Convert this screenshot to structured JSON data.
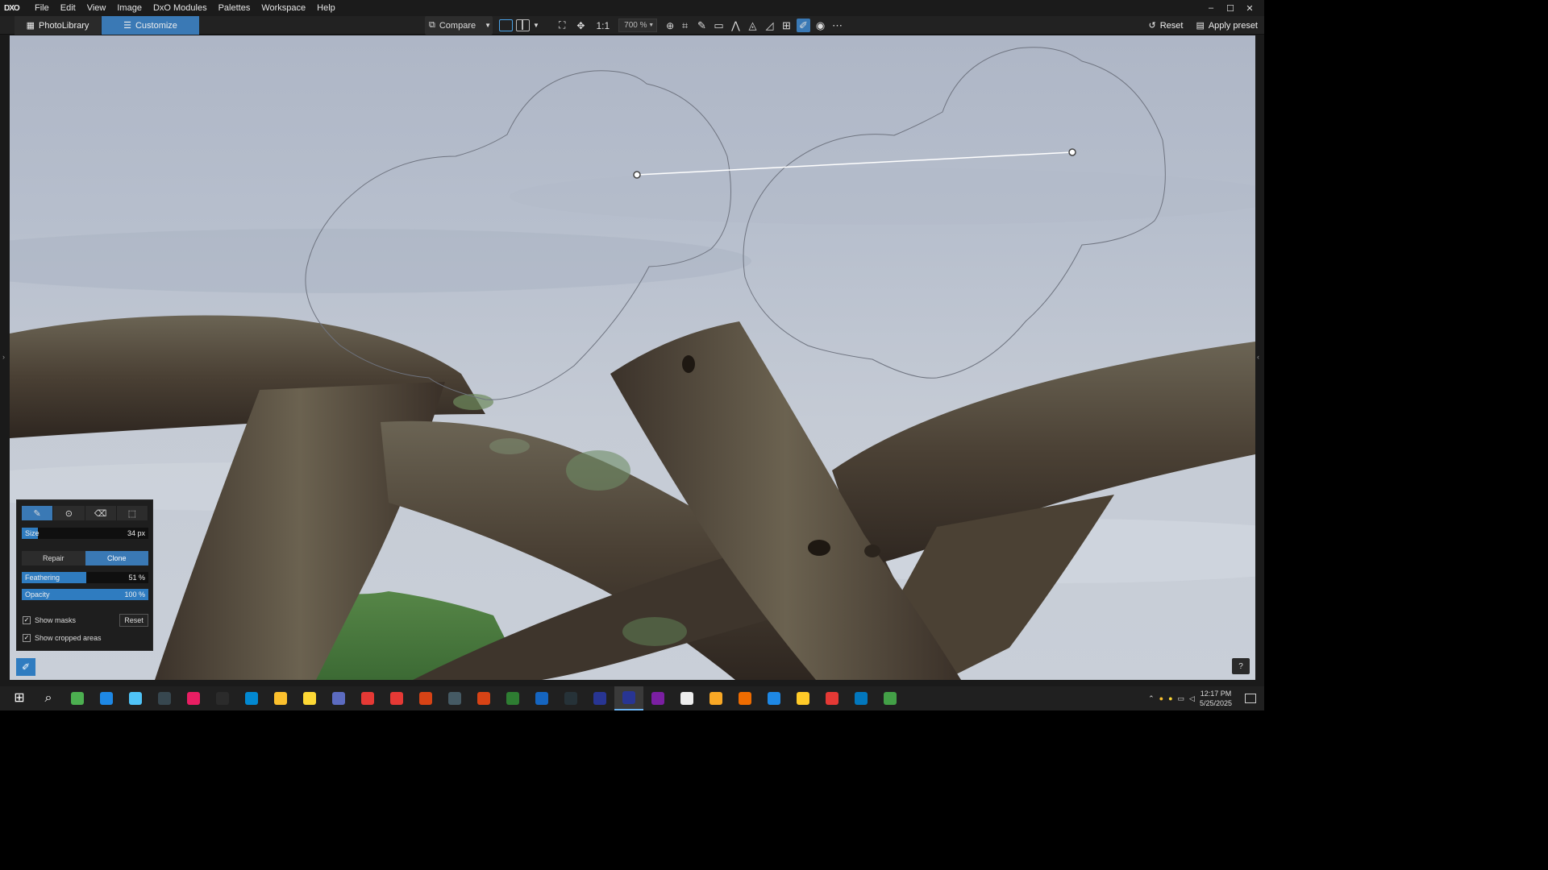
{
  "menubar": {
    "logo": "DXO",
    "items": [
      "File",
      "Edit",
      "View",
      "Image",
      "DxO Modules",
      "Palettes",
      "Workspace",
      "Help"
    ],
    "window_controls": [
      "–",
      "☐",
      "✕"
    ]
  },
  "toolbar": {
    "tab_library": "PhotoLibrary",
    "tab_customize": "Customize",
    "compare_label": "Compare",
    "one_to_one": "1:1",
    "zoom_value": "700 %",
    "reset_label": "Reset",
    "apply_preset_label": "Apply preset"
  },
  "palette": {
    "size_label": "Size",
    "size_value": "34 px",
    "size_fraction": 0.13,
    "mode_repair": "Repair",
    "mode_clone": "Clone",
    "feathering_label": "Feathering",
    "feathering_value": "51 %",
    "feathering_fraction": 0.51,
    "opacity_label": "Opacity",
    "opacity_value": "100 %",
    "opacity_fraction": 1.0,
    "show_masks_label": "Show masks",
    "show_masks_checked": true,
    "reset_label": "Reset",
    "show_cropped_label": "Show cropped areas",
    "show_cropped_checked": true
  },
  "help_label": "?",
  "taskbar": {
    "time": "12:17 PM",
    "date": "5/25/2025",
    "apps": [
      {
        "name": "start",
        "color": "#2b2b2b",
        "glyph": "⊞"
      },
      {
        "name": "search",
        "color": "#2b2b2b",
        "glyph": "⌕"
      },
      {
        "name": "app-bird",
        "color": "#4caf50",
        "glyph": ""
      },
      {
        "name": "edge",
        "color": "#1e88e5",
        "glyph": ""
      },
      {
        "name": "mail",
        "color": "#4fc3f7",
        "glyph": ""
      },
      {
        "name": "app-dark",
        "color": "#37474f",
        "glyph": ""
      },
      {
        "name": "itunes",
        "color": "#e91e63",
        "glyph": ""
      },
      {
        "name": "speed",
        "color": "#2b2b2b",
        "glyph": ""
      },
      {
        "name": "store",
        "color": "#0288d1",
        "glyph": ""
      },
      {
        "name": "explorer",
        "color": "#fbc02d",
        "glyph": ""
      },
      {
        "name": "app-yellow",
        "color": "#fdd835",
        "glyph": ""
      },
      {
        "name": "app-gray",
        "color": "#5c6bc0",
        "glyph": ""
      },
      {
        "name": "app-red",
        "color": "#e53935",
        "glyph": ""
      },
      {
        "name": "todo",
        "color": "#e53935",
        "glyph": ""
      },
      {
        "name": "acrobat",
        "color": "#d84315",
        "glyph": ""
      },
      {
        "name": "app-white",
        "color": "#455a64",
        "glyph": ""
      },
      {
        "name": "powerpoint",
        "color": "#d84315",
        "glyph": ""
      },
      {
        "name": "excel",
        "color": "#2e7d32",
        "glyph": ""
      },
      {
        "name": "word",
        "color": "#1565c0",
        "glyph": ""
      },
      {
        "name": "viewpoint",
        "color": "#263238",
        "glyph": ""
      },
      {
        "name": "photolab-1",
        "color": "#283593",
        "glyph": ""
      },
      {
        "name": "photolab-2",
        "color": "#283593",
        "glyph": ""
      },
      {
        "name": "app-purple",
        "color": "#7b1fa2",
        "glyph": ""
      },
      {
        "name": "app-camera",
        "color": "#eeeeee",
        "glyph": ""
      },
      {
        "name": "app-gold",
        "color": "#f9a825",
        "glyph": ""
      },
      {
        "name": "app-orange",
        "color": "#ef6c00",
        "glyph": ""
      },
      {
        "name": "app-blue",
        "color": "#1e88e5",
        "glyph": ""
      },
      {
        "name": "app-sticky",
        "color": "#ffca28",
        "glyph": ""
      },
      {
        "name": "app-q",
        "color": "#e53935",
        "glyph": ""
      },
      {
        "name": "outlook",
        "color": "#0277bd",
        "glyph": ""
      },
      {
        "name": "chrome",
        "color": "#43a047",
        "glyph": ""
      }
    ]
  },
  "colors": {
    "accent": "#3a79b5",
    "slider_fill": "#2f7cc0",
    "sky": "#b7bfcd",
    "wood": "#4a4034"
  }
}
